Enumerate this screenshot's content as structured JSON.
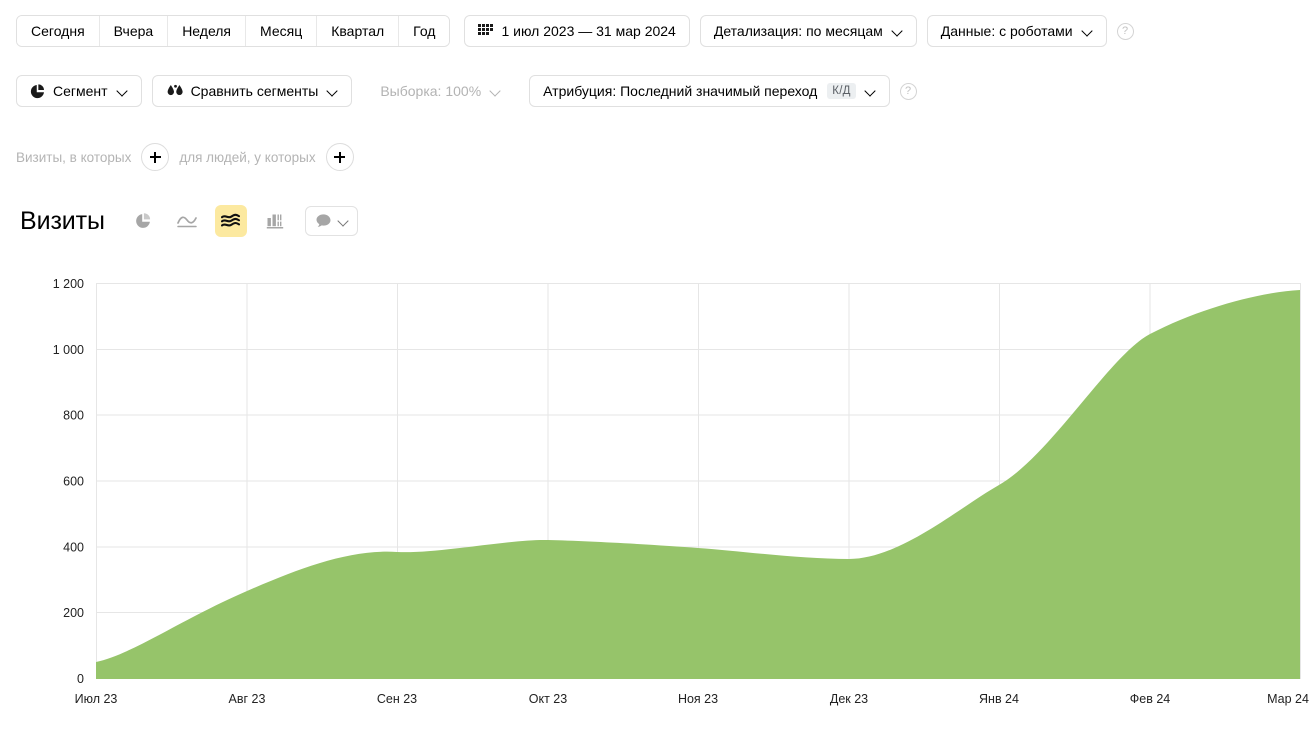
{
  "toolbar": {
    "period_buttons": [
      {
        "label": "Сегодня",
        "name": "period-today"
      },
      {
        "label": "Вчера",
        "name": "period-yesterday"
      },
      {
        "label": "Неделя",
        "name": "period-week"
      },
      {
        "label": "Месяц",
        "name": "period-month"
      },
      {
        "label": "Квартал",
        "name": "period-quarter"
      },
      {
        "label": "Год",
        "name": "period-year"
      }
    ],
    "date_range": "1 июл 2023 — 31 мар 2024",
    "detail": "Детализация: по месяцам",
    "data_source": "Данные: с роботами",
    "help": "?",
    "segment": "Сегмент",
    "compare_segments": "Сравнить сегменты",
    "sampling": "Выборка: 100%",
    "attribution": "Атрибуция: Последний значимый переход",
    "attribution_badge": "К/Д",
    "attribution_help": "?"
  },
  "filters": {
    "visits_label": "Визиты, в которых",
    "people_label": "для людей, у которых",
    "add_visit_filter": "+",
    "add_people_filter": "+"
  },
  "chart_header": {
    "title": "Визиты",
    "view_types": [
      {
        "name": "pie-chart-icon",
        "label": "Круговая диаграмма",
        "active": false
      },
      {
        "name": "line-chart-icon",
        "label": "Линейный график",
        "active": false
      },
      {
        "name": "area-chart-icon",
        "label": "График с областями",
        "active": true
      },
      {
        "name": "bar-chart-icon",
        "label": "Столбчатая диаграмма",
        "active": false
      }
    ],
    "comment_button": "Комментарии"
  },
  "colors": {
    "area_fill": "#96c46a",
    "accent_selected": "#fce9a0",
    "grid": "#e6e6e6",
    "axis_text": "#222222",
    "muted_text": "#b4b4b4"
  },
  "chart_data": {
    "type": "area",
    "title": "Визиты",
    "xlabel": "",
    "ylabel": "",
    "categories": [
      "Июл 23",
      "Авг 23",
      "Сен 23",
      "Окт 23",
      "Ноя 23",
      "Дек 23",
      "Янв 24",
      "Фев 24",
      "Мар 24"
    ],
    "values": [
      50,
      265,
      385,
      420,
      408,
      365,
      588,
      1048,
      1180
    ],
    "series": [
      {
        "name": "Визиты",
        "values": [
          50,
          265,
          385,
          420,
          408,
          365,
          588,
          1048,
          1180
        ]
      }
    ],
    "ylim": [
      0,
      1200
    ],
    "yticks": [
      0,
      200,
      400,
      600,
      800,
      1000,
      1200
    ],
    "ytick_labels": [
      "0",
      "200",
      "400",
      "600",
      "800",
      "1 000",
      "1 200"
    ],
    "grid": true,
    "legend": "none"
  }
}
